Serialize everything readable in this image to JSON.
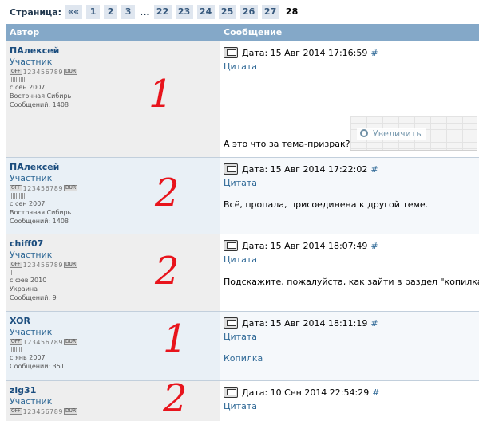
{
  "pager": {
    "label": "Страница:",
    "first": "««",
    "pages": [
      "1",
      "2",
      "3"
    ],
    "ellipsis": "...",
    "pages2": [
      "22",
      "23",
      "24",
      "25",
      "26",
      "27"
    ],
    "current": "28"
  },
  "table": {
    "col_author": "Автор",
    "col_message": "Сообщение"
  },
  "posts": [
    {
      "author": "ПАлексей",
      "rank": "Участник",
      "status": "OFF 123456789 DUR",
      "since": "с сен 2007",
      "location": "Восточная Сибирь",
      "count": "Сообщений: 1408",
      "date": "Дата: 15 Авг 2014 17:16:59",
      "hash": "#",
      "quote": "Цитата",
      "text": "А это что за тема-призрак?",
      "thumb_label": "Увеличить",
      "mark": "1"
    },
    {
      "author": "ПАлексей",
      "rank": "Участник",
      "status": "OFF 123456789 DUR",
      "since": "с сен 2007",
      "location": "Восточная Сибирь",
      "count": "Сообщений: 1408",
      "date": "Дата: 15 Авг 2014 17:22:02",
      "hash": "#",
      "quote": "Цитата",
      "text": "Всё, пропала, присоединена к другой теме.",
      "mark": "2"
    },
    {
      "author": "chiff07",
      "rank": "Участник",
      "status": "OFF 123456789 DUR",
      "since": "с фев 2010",
      "location": "Украина",
      "count": "Сообщений: 9",
      "date": "Дата: 15 Авг 2014 18:07:49",
      "hash": "#",
      "quote": "Цитата",
      "text": "Подскажите, пожалуйста, как зайти в раздел \"копилка\"?",
      "mark": "2"
    },
    {
      "author": "XOR",
      "rank": "Участник",
      "status": "OFF 123456789 DUR",
      "since": "с янв 2007",
      "location": "",
      "count": "Сообщений: 351",
      "date": "Дата: 15 Авг 2014 18:11:19",
      "hash": "#",
      "quote": "Цитата",
      "link": "Копилка",
      "mark": "1"
    },
    {
      "author": "zig31",
      "rank": "Участник",
      "status": "OFF 123456789 DUR",
      "date": "Дата: 10 Сен 2014 22:54:29",
      "hash": "#",
      "quote": "Цитата",
      "mark": "2"
    }
  ],
  "colors": {
    "header_bg": "#84a8c8",
    "link": "#2e6896",
    "annotation": "#e8141c"
  }
}
